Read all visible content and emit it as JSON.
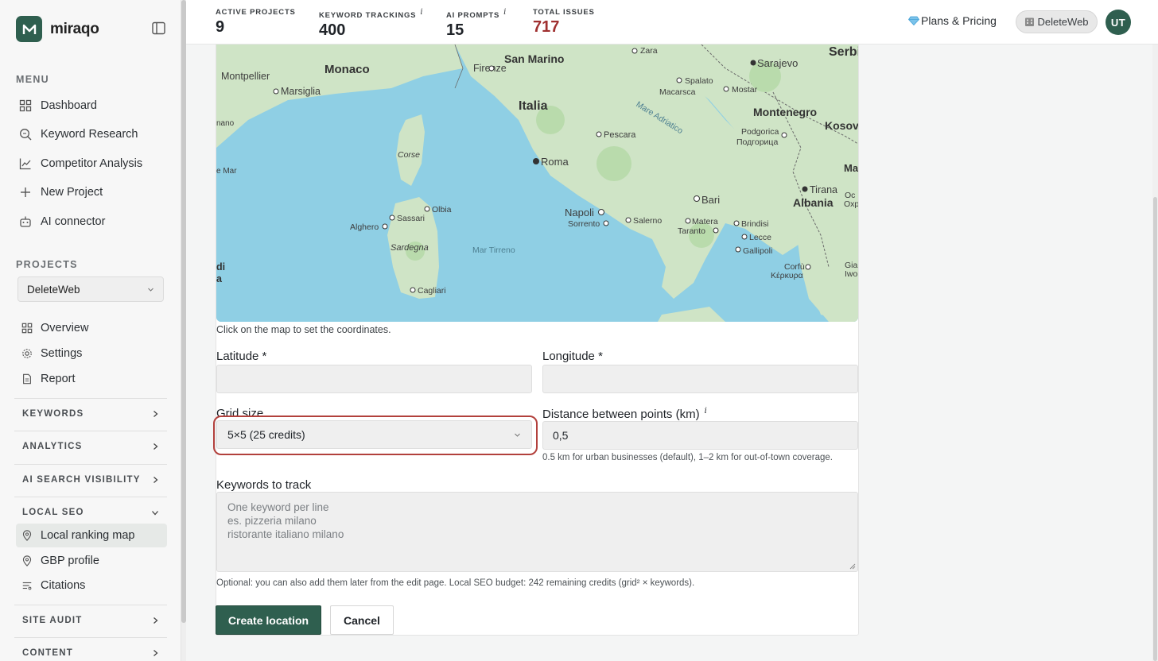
{
  "brand": {
    "name": "miraqo"
  },
  "sidebar": {
    "menu_label": "MENU",
    "menu": [
      {
        "label": "Dashboard",
        "icon": "grid-icon"
      },
      {
        "label": "Keyword Research",
        "icon": "search-icon"
      },
      {
        "label": "Competitor Analysis",
        "icon": "chart-line-icon"
      },
      {
        "label": "New Project",
        "icon": "plus-icon"
      },
      {
        "label": "AI connector",
        "icon": "robot-icon"
      }
    ],
    "projects_label": "PROJECTS",
    "project_selected": "DeleteWeb",
    "project_items": [
      {
        "label": "Overview",
        "icon": "grid-icon"
      },
      {
        "label": "Settings",
        "icon": "gear-icon"
      },
      {
        "label": "Report",
        "icon": "document-icon"
      }
    ],
    "groups": {
      "keywords": "KEYWORDS",
      "analytics": "ANALYTICS",
      "ai_search": "AI SEARCH VISIBILITY",
      "local_seo": "LOCAL SEO",
      "site_audit": "SITE AUDIT",
      "content": "CONTENT"
    },
    "local_seo_items": [
      {
        "label": "Local ranking map",
        "icon": "pin-icon",
        "active": true
      },
      {
        "label": "GBP profile",
        "icon": "pin-icon",
        "active": false
      },
      {
        "label": "Citations",
        "icon": "list-icon",
        "active": false
      }
    ]
  },
  "topbar": {
    "stats": [
      {
        "label": "ACTIVE PROJECTS",
        "value": "9",
        "info": ""
      },
      {
        "label": "KEYWORD TRACKINGS",
        "value": "400",
        "info": "i"
      },
      {
        "label": "AI PROMPTS",
        "value": "15",
        "info": "i"
      },
      {
        "label": "TOTAL ISSUES",
        "value": "717",
        "info": ""
      }
    ],
    "plans_label": "Plans & Pricing",
    "project_chip": "DeleteWeb",
    "avatar_initials": "UT",
    "issues_color": "#a03030"
  },
  "map": {
    "note": "Click on the map to set the coordinates.",
    "labels": {
      "monaco": "Monaco",
      "montpellier": "Montpellier",
      "marsiglia": "Marsiglia",
      "nano": "nano",
      "mar": "e Mar",
      "san_marino": "San Marino",
      "firenze": "Firenze",
      "italia": "Italia",
      "zara": "Zara",
      "spalato": "Spalato",
      "macarsca": "Macarsca",
      "mostar": "Mostar",
      "sarajevo": "Sarajevo",
      "serbia": "Serbia",
      "montenegro": "Montenegro",
      "kosov": "Kosov",
      "podgorica": "Podgorica",
      "podgorica_cyr": "Подгорица",
      "mare_adriatico": "Mare Adriatico",
      "pescara": "Pescara",
      "corse": "Corse",
      "roma": "Roma",
      "bari": "Bari",
      "tirana": "Tirana",
      "albania": "Albania",
      "olbia": "Olbia",
      "sassari": "Sassari",
      "alghero": "Alghero",
      "napoli": "Napoli",
      "salerno": "Salerno",
      "sorrento": "Sorrento",
      "matera": "Matera",
      "brindisi": "Brindisi",
      "taranto": "Taranto",
      "lecce": "Lecce",
      "gallipoli": "Gallipoli",
      "sardegna": "Sardegna",
      "mar_tirreno": "Mar Tirreno",
      "cagliari": "Cagliari",
      "corfu": "Corfù",
      "corfu_gr": "Κέρκυρα",
      "di": "di",
      "a": "a",
      "ma": "Ma",
      "oc": "Oc",
      "oxp": "Oxp",
      "gia": "Gia",
      "iwo": "Iwo"
    }
  },
  "form": {
    "latitude_label": "Latitude *",
    "latitude_value": "",
    "longitude_label": "Longitude *",
    "longitude_value": "",
    "grid_label": "Grid size",
    "grid_value": "5×5 (25 credits)",
    "distance_label": "Distance between points (km)",
    "distance_info": "i",
    "distance_value": "0,5",
    "distance_hint": "0.5 km for urban businesses (default), 1–2 km for out-of-town coverage.",
    "keywords_label": "Keywords to track",
    "keywords_placeholder_lines": [
      "One keyword per line",
      "es. pizzeria milano",
      "ristorante italiano milano"
    ],
    "keywords_hint": "Optional: you can also add them later from the edit page. Local SEO budget: 242 remaining credits (grid² × keywords).",
    "create_label": "Create location",
    "cancel_label": "Cancel"
  },
  "colors": {
    "brand": "#2f5f4f",
    "focus_ring": "#b2403c",
    "sea": "#8fcfe4",
    "land": "#cfe4c6"
  }
}
